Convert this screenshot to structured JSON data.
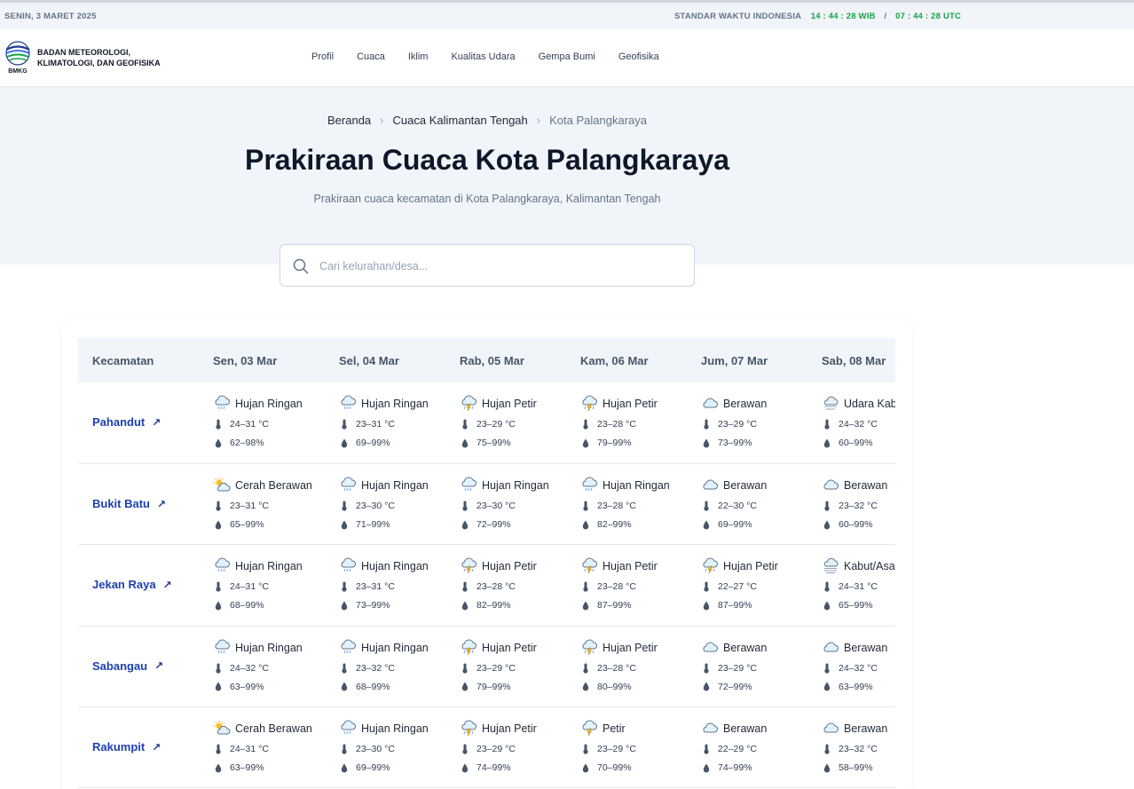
{
  "topbar": {
    "date": "SENIN, 3 MARET 2025",
    "clock_label": "STANDAR WAKTU INDONESIA",
    "time_wib": "14 : 44 : 28 WIB",
    "separator": "/",
    "time_utc": "07 : 44 : 28 UTC"
  },
  "header": {
    "logo_text": "BMKG",
    "brand_line1": "BADAN METEOROLOGI,",
    "brand_line2": "KLIMATOLOGI, DAN GEOFISIKA",
    "nav": [
      "Profil",
      "Cuaca",
      "Iklim",
      "Kualitas Udara",
      "Gempa Bumi",
      "Geofisika"
    ]
  },
  "breadcrumb": [
    "Beranda",
    "Cuaca Kalimantan Tengah",
    "Kota Palangkaraya"
  ],
  "page": {
    "title": "Prakiraan Cuaca Kota Palangkaraya",
    "subtitle": "Prakiraan cuaca kecamatan di Kota Palangkaraya, Kalimantan Tengah"
  },
  "search": {
    "placeholder": "Cari kelurahan/desa..."
  },
  "table": {
    "header_first": "Kecamatan",
    "days": [
      "Sen, 03 Mar",
      "Sel, 04 Mar",
      "Rab, 05 Mar",
      "Kam, 06 Mar",
      "Jum, 07 Mar",
      "Sab, 08 Mar"
    ],
    "rows": [
      {
        "name": "Pahandut",
        "cells": [
          {
            "cond": "Hujan Ringan",
            "icon": "rain",
            "temp": "24–31 °C",
            "hum": "62–98%"
          },
          {
            "cond": "Hujan Ringan",
            "icon": "rain",
            "temp": "23–31 °C",
            "hum": "69–99%"
          },
          {
            "cond": "Hujan Petir",
            "icon": "thunder-rain",
            "temp": "23–29 °C",
            "hum": "75–99%"
          },
          {
            "cond": "Hujan Petir",
            "icon": "thunder-rain",
            "temp": "23–28 °C",
            "hum": "79–99%"
          },
          {
            "cond": "Berawan",
            "icon": "cloud",
            "temp": "23–29 °C",
            "hum": "73–99%"
          },
          {
            "cond": "Udara Kabur",
            "icon": "haze",
            "temp": "24–32 °C",
            "hum": "60–99%"
          }
        ]
      },
      {
        "name": "Bukit Batu",
        "cells": [
          {
            "cond": "Cerah Berawan",
            "icon": "sun-cloud",
            "temp": "23–31 °C",
            "hum": "65–99%"
          },
          {
            "cond": "Hujan Ringan",
            "icon": "rain",
            "temp": "23–30 °C",
            "hum": "71–99%"
          },
          {
            "cond": "Hujan Ringan",
            "icon": "rain",
            "temp": "23–30 °C",
            "hum": "72–99%"
          },
          {
            "cond": "Hujan Ringan",
            "icon": "rain",
            "temp": "23–28 °C",
            "hum": "82–99%"
          },
          {
            "cond": "Berawan",
            "icon": "cloud",
            "temp": "22–30 °C",
            "hum": "69–99%"
          },
          {
            "cond": "Berawan",
            "icon": "cloud",
            "temp": "23–32 °C",
            "hum": "60–99%"
          }
        ]
      },
      {
        "name": "Jekan Raya",
        "cells": [
          {
            "cond": "Hujan Ringan",
            "icon": "rain",
            "temp": "24–31 °C",
            "hum": "68–99%"
          },
          {
            "cond": "Hujan Ringan",
            "icon": "rain",
            "temp": "23–31 °C",
            "hum": "73–99%"
          },
          {
            "cond": "Hujan Petir",
            "icon": "thunder-rain",
            "temp": "23–28 °C",
            "hum": "82–99%"
          },
          {
            "cond": "Hujan Petir",
            "icon": "thunder-rain",
            "temp": "23–28 °C",
            "hum": "87–99%"
          },
          {
            "cond": "Hujan Petir",
            "icon": "thunder-rain",
            "temp": "22–27 °C",
            "hum": "87–99%"
          },
          {
            "cond": "Kabut/Asap",
            "icon": "fog",
            "temp": "24–31 °C",
            "hum": "65–99%"
          }
        ]
      },
      {
        "name": "Sabangau",
        "cells": [
          {
            "cond": "Hujan Ringan",
            "icon": "rain",
            "temp": "24–32 °C",
            "hum": "63–99%"
          },
          {
            "cond": "Hujan Ringan",
            "icon": "rain",
            "temp": "23–32 °C",
            "hum": "68–99%"
          },
          {
            "cond": "Hujan Petir",
            "icon": "thunder-rain",
            "temp": "23–29 °C",
            "hum": "79–99%"
          },
          {
            "cond": "Hujan Petir",
            "icon": "thunder-rain",
            "temp": "23–28 °C",
            "hum": "80–99%"
          },
          {
            "cond": "Berawan",
            "icon": "cloud",
            "temp": "23–29 °C",
            "hum": "72–99%"
          },
          {
            "cond": "Berawan",
            "icon": "cloud",
            "temp": "24–32 °C",
            "hum": "63–99%"
          }
        ]
      },
      {
        "name": "Rakumpit",
        "cells": [
          {
            "cond": "Cerah Berawan",
            "icon": "sun-cloud",
            "temp": "24–31 °C",
            "hum": "63–99%"
          },
          {
            "cond": "Hujan Ringan",
            "icon": "rain",
            "temp": "23–30 °C",
            "hum": "69–99%"
          },
          {
            "cond": "Hujan Petir",
            "icon": "thunder-rain",
            "temp": "23–29 °C",
            "hum": "74–99%"
          },
          {
            "cond": "Petir",
            "icon": "thunder",
            "temp": "23–29 °C",
            "hum": "70–99%"
          },
          {
            "cond": "Berawan",
            "icon": "cloud",
            "temp": "22–29 °C",
            "hum": "74–99%"
          },
          {
            "cond": "Berawan",
            "icon": "cloud",
            "temp": "23–32 °C",
            "hum": "58–99%"
          }
        ]
      }
    ]
  },
  "colors": {
    "accent_link": "#1e40af",
    "clock_green": "#16a34a",
    "hero_bg": "#f1f5f9"
  }
}
